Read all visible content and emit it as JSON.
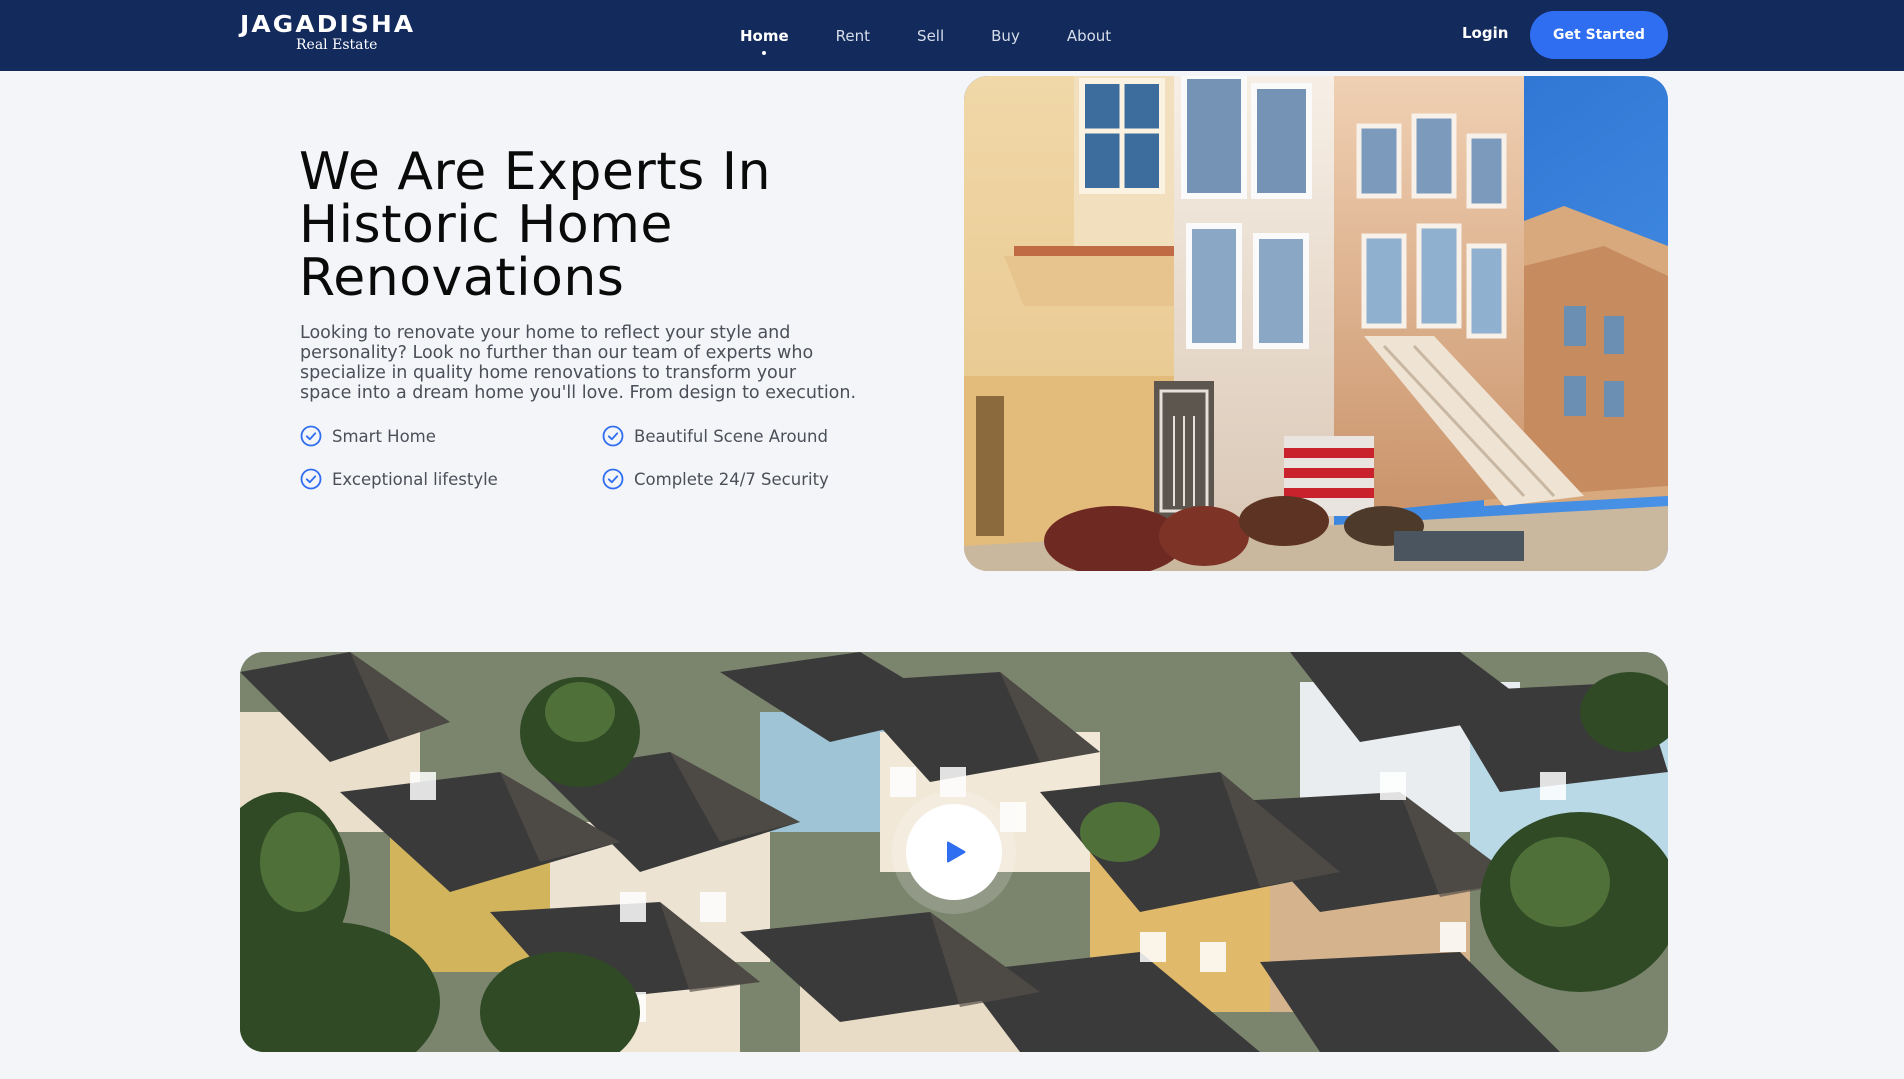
{
  "brand": {
    "name": "JAGADISHA",
    "tagline": "Real Estate"
  },
  "nav": {
    "links": [
      {
        "label": "Home",
        "active": true
      },
      {
        "label": "Rent",
        "active": false
      },
      {
        "label": "Sell",
        "active": false
      },
      {
        "label": "Buy",
        "active": false
      },
      {
        "label": "About",
        "active": false
      }
    ],
    "login_label": "Login",
    "cta_label": "Get Started"
  },
  "hero": {
    "title_lines": [
      "We Are Experts In",
      "Historic Home",
      "Renovations"
    ],
    "description_lines": [
      "Looking to renovate your home to reflect your style and",
      "personality? Look no further than our team of experts who",
      "specialize in quality home renovations to transform your",
      "space into a dream home you'll love. From design to execution."
    ],
    "features": [
      "Smart Home",
      "Beautiful Scene Around",
      "Exceptional lifestyle",
      "Complete 24/7 Security"
    ],
    "image_alt_icon": "victorian-houses-photo"
  },
  "video": {
    "thumbnail_icon": "aerial-neighborhood-photo",
    "play_icon": "play-icon"
  },
  "colors": {
    "navbar": "#132a5c",
    "accent": "#2f6df1",
    "page_background": "#f3f5f9",
    "check": "#2f6df1"
  }
}
